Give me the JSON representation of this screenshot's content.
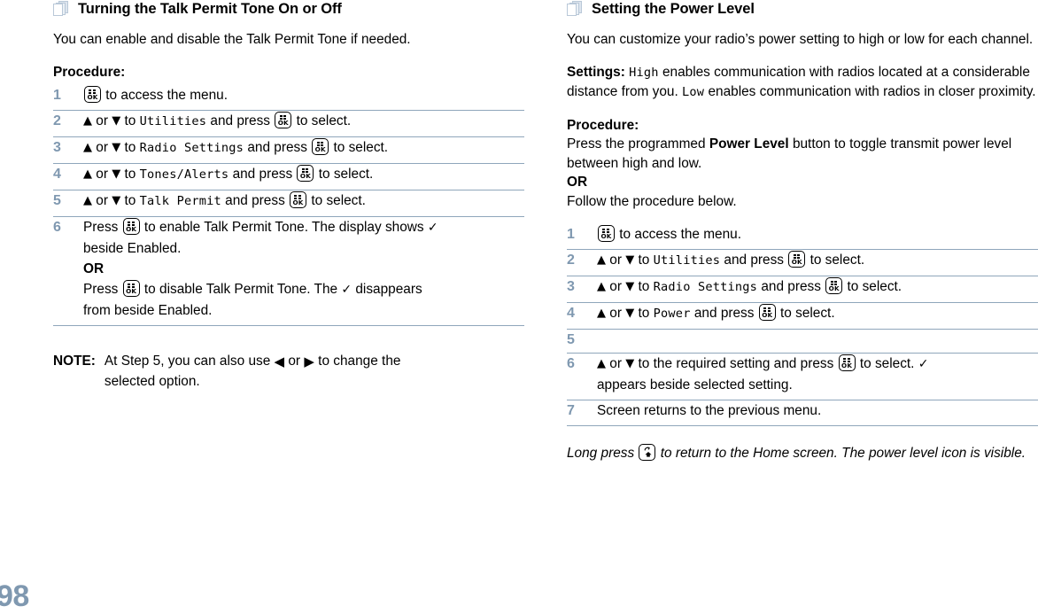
{
  "page_number": "98",
  "left_column": {
    "heading": "Turning the Talk Permit Tone On or Off",
    "heading_icon": "stacked-pages-icon",
    "intro": "You can enable and disable the Talk Permit Tone if needed.",
    "procedure_label": "Procedure:",
    "steps": [
      {
        "number": "1",
        "parts": [
          "ok-key-icon",
          " to access the menu."
        ]
      },
      {
        "number": "2",
        "pre": "",
        "arrows": [
          "up-arrow-icon",
          "down-arrow-icon"
        ],
        "or": "or",
        "to": "to",
        "menu_item": "Utilities",
        "and_press": "and press",
        "key": "ok-key-icon",
        "tail": "to select."
      },
      {
        "number": "3",
        "menu_item": "Radio Settings",
        "tail": "to select."
      },
      {
        "number": "4",
        "menu_item": "Tones/Alerts",
        "tail": "to select."
      },
      {
        "number": "5",
        "menu_item": "Talk Permit",
        "tail": "to select."
      },
      {
        "number": "6",
        "line1_a": "Press",
        "line1_b": "to enable Talk Permit Tone. The display shows",
        "line1_check": "✓",
        "line2": "beside Enabled.",
        "or_label": "OR",
        "line3_a": "Press",
        "line3_b": "to disable Talk Permit Tone. The",
        "line3_check": "✓",
        "line3_c": "disappears",
        "line4": "from beside Enabled."
      }
    ],
    "note": {
      "label": "NOTE:",
      "text_a": "At Step 5, you can also use",
      "text_or": "or",
      "text_b": "to change the",
      "text_c": "selected option.",
      "left_arrow": "left-arrow-icon",
      "right_arrow": "right-arrow-icon"
    }
  },
  "right_column": {
    "heading": "Setting the Power Level",
    "heading_icon": "stacked-pages-icon",
    "intro": "You can customize your radio’s power setting to high or low for each channel.",
    "settings_label": "Settings:",
    "settings_high": "High",
    "settings_text_a": "enables communication with radios located at a considerable distance from you.",
    "settings_low": "Low",
    "settings_text_b": "enables communication with radios in closer proximity.",
    "procedure_label": "Procedure:",
    "procedure_line1_a": "Press the programmed",
    "procedure_bold": "Power Level",
    "procedure_line1_b": "button to toggle transmit power level between high and low.",
    "or_label": "OR",
    "procedure_line2": "Follow the procedure below.",
    "steps": [
      {
        "number": "1",
        "tail": "to access the menu."
      },
      {
        "number": "2",
        "menu_item": "Utilities",
        "tail": "to select."
      },
      {
        "number": "3",
        "menu_item": "Radio Settings",
        "tail": "to select."
      },
      {
        "number": "4",
        "menu_item": "Power",
        "tail": "to select."
      },
      {
        "number": "5",
        "empty": true
      },
      {
        "number": "6",
        "line1_a": "to the required setting and press",
        "line1_b": "to select.",
        "line1_check": "✓",
        "line2": "appears beside selected setting."
      },
      {
        "number": "7",
        "text": "Screen returns to the previous menu."
      }
    ],
    "footer_a": "Long press",
    "footer_icon": "back-home-key-icon",
    "footer_b": "to return to the Home screen. The power level icon is visible."
  },
  "labels": {
    "or": "or",
    "to": "to",
    "and_press": "and press",
    "press": "Press"
  },
  "colors": {
    "accent": "#7f98b0",
    "rule": "#8fa6bb",
    "icon_outline": "#b9c8d8"
  }
}
